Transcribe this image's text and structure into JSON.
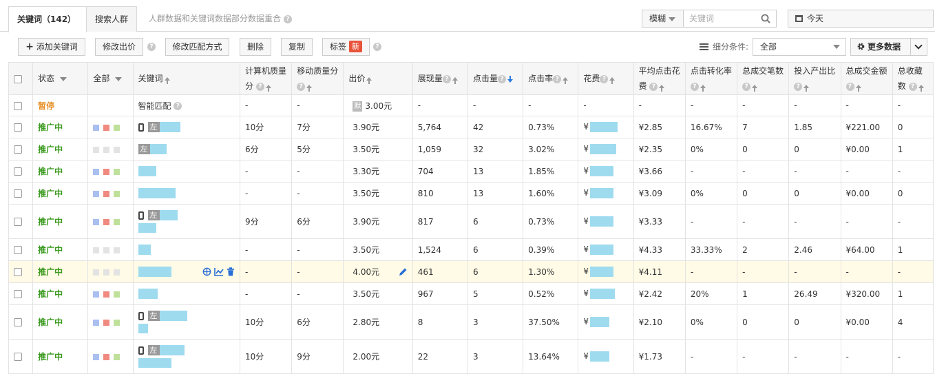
{
  "tabs": [
    {
      "label": "关键词（142）",
      "active": true
    },
    {
      "label": "搜索人群",
      "active": false
    }
  ],
  "tab_note": "人群数据和关键词数据部分数据重合",
  "search": {
    "mode": "模糊",
    "placeholder": "关键词"
  },
  "date": "今天",
  "toolbar": {
    "add": "添加关键词",
    "modify_bid": "修改出价",
    "modify_match": "修改匹配方式",
    "delete": "删除",
    "copy": "复制",
    "tag": "标签",
    "new_badge": "新",
    "segment_label": "细分条件:",
    "segment_value": "全部",
    "more_data": "更多数据"
  },
  "columns": {
    "status": "状态",
    "all": "全部",
    "keyword": "关键词",
    "pc_quality": "计算机质量分",
    "mobile_quality": "移动质量分",
    "bid": "出价",
    "impressions": "展现量",
    "clicks": "点击量",
    "ctr": "点击率",
    "cost": "花费",
    "avg_cpc": "平均点击花费",
    "conv_rate": "点击转化率",
    "total_orders": "总成交笔数",
    "roi": "投入产出比",
    "total_gmv": "总成交金额",
    "total_fav": "总收藏数"
  },
  "colors": {
    "dot_blue": "#a9bff0",
    "dot_red": "#f08a80",
    "dot_green": "#bfe09a",
    "dot_grey": "#e3e3e3",
    "blur": "#9fdbef"
  },
  "rows": [
    {
      "status": "暂停",
      "keyword": "智能匹配",
      "pc": "-",
      "mobile": "-",
      "bid_tag": "默",
      "bid": "3.00元",
      "imp": "-",
      "clk": "-",
      "ctr": "-",
      "cost": "-",
      "cpc": "-",
      "conv": "-",
      "orders": "-",
      "roi": "-",
      "gmv": "-",
      "fav": "-"
    },
    {
      "status": "推广中",
      "left_tag": "左",
      "pc": "10分",
      "mobile": "7分",
      "bid": "3.90元",
      "imp": "5,764",
      "clk": "42",
      "ctr": "0.73%",
      "cost": "¥",
      "cpc": "¥2.85",
      "conv": "16.67%",
      "orders": "7",
      "roi": "1.85",
      "gmv": "¥221.00",
      "fav": "0"
    },
    {
      "status": "推广中",
      "left_tag": "左",
      "pc": "6分",
      "mobile": "5分",
      "bid": "3.50元",
      "imp": "1,059",
      "clk": "32",
      "ctr": "3.02%",
      "cost": "¥",
      "cpc": "¥2.35",
      "conv": "0%",
      "orders": "0",
      "roi": "0",
      "gmv": "¥0.00",
      "fav": "1"
    },
    {
      "status": "推广中",
      "pc": "-",
      "mobile": "-",
      "bid": "3.30元",
      "imp": "704",
      "clk": "13",
      "ctr": "1.85%",
      "cost": "¥",
      "cpc": "¥3.66",
      "conv": "-",
      "orders": "-",
      "roi": "-",
      "gmv": "-",
      "fav": "-"
    },
    {
      "status": "推广中",
      "pc": "-",
      "mobile": "-",
      "bid": "3.50元",
      "imp": "810",
      "clk": "13",
      "ctr": "1.60%",
      "cost": "¥",
      "cpc": "¥3.09",
      "conv": "0%",
      "orders": "0",
      "roi": "0",
      "gmv": "¥0.00",
      "fav": "0"
    },
    {
      "status": "推广中",
      "left_tag": "左",
      "pc": "9分",
      "mobile": "6分",
      "bid": "3.90元",
      "imp": "817",
      "clk": "6",
      "ctr": "0.73%",
      "cost": "¥",
      "cpc": "¥3.33",
      "conv": "-",
      "orders": "-",
      "roi": "-",
      "gmv": "-",
      "fav": "-"
    },
    {
      "status": "推广中",
      "pc": "-",
      "mobile": "-",
      "bid": "3.50元",
      "imp": "1,524",
      "clk": "6",
      "ctr": "0.39%",
      "cost": "¥",
      "cpc": "¥4.33",
      "conv": "33.33%",
      "orders": "2",
      "roi": "2.46",
      "gmv": "¥64.00",
      "fav": "1"
    },
    {
      "status": "推广中",
      "pc": "-",
      "mobile": "-",
      "bid": "4.00元",
      "imp": "461",
      "clk": "6",
      "ctr": "1.30%",
      "cost": "¥",
      "cpc": "¥4.11",
      "conv": "-",
      "orders": "-",
      "roi": "-",
      "gmv": "-",
      "fav": "-"
    },
    {
      "status": "推广中",
      "pc": "-",
      "mobile": "-",
      "bid": "3.50元",
      "imp": "967",
      "clk": "5",
      "ctr": "0.52%",
      "cost": "¥",
      "cpc": "¥2.42",
      "conv": "20%",
      "orders": "1",
      "roi": "26.49",
      "gmv": "¥320.00",
      "fav": "1"
    },
    {
      "status": "推广中",
      "left_tag": "左",
      "pc": "10分",
      "mobile": "6分",
      "bid": "2.80元",
      "imp": "8",
      "clk": "3",
      "ctr": "37.50%",
      "cost": "¥",
      "cpc": "¥2.10",
      "conv": "0%",
      "orders": "0",
      "roi": "0",
      "gmv": "¥0.00",
      "fav": "4"
    },
    {
      "status": "推广中",
      "left_tag": "左",
      "pc": "10分",
      "mobile": "9分",
      "bid": "2.00元",
      "imp": "22",
      "clk": "3",
      "ctr": "13.64%",
      "cost": "¥",
      "cpc": "¥1.73",
      "conv": "-",
      "orders": "-",
      "roi": "-",
      "gmv": "-",
      "fav": "-"
    }
  ]
}
